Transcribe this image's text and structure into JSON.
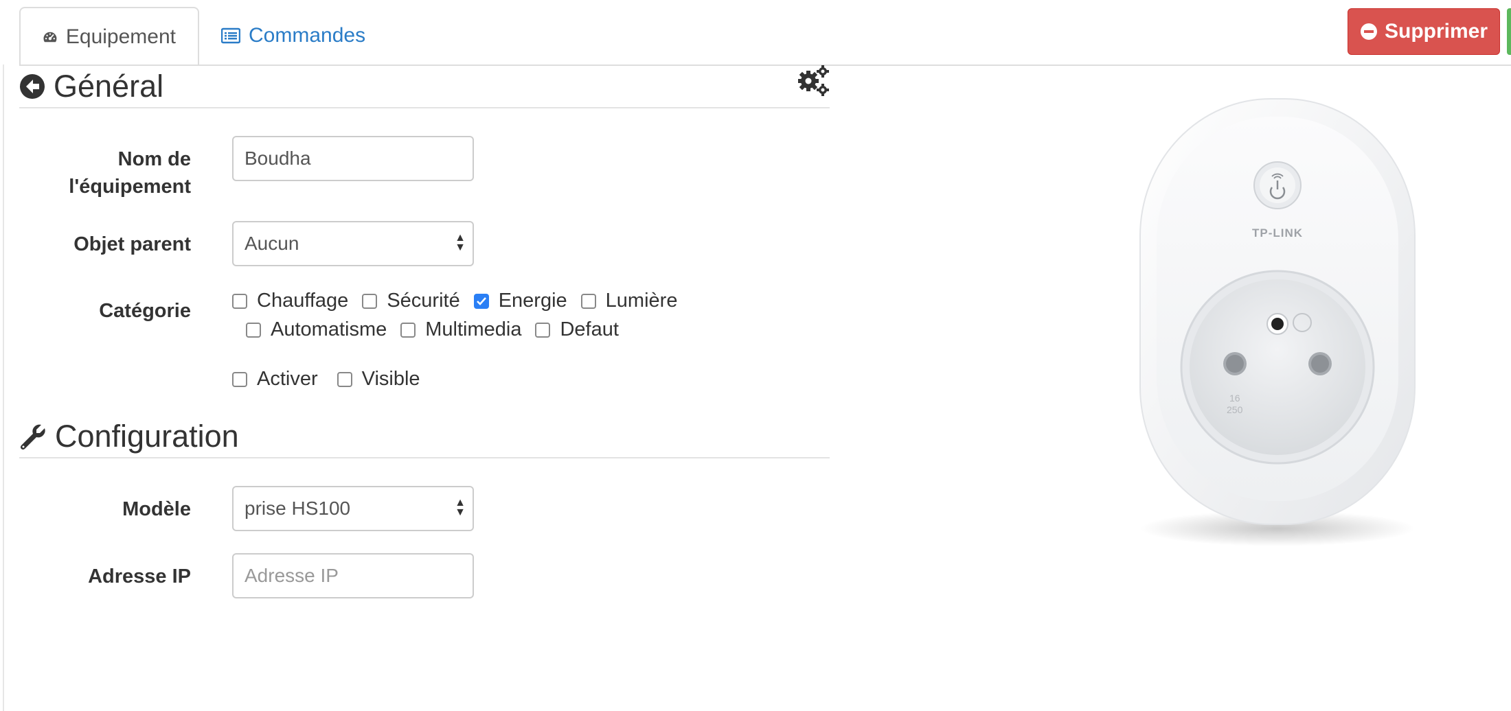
{
  "tabs": [
    {
      "label": "Equipement",
      "icon": "tachometer-icon",
      "active": true
    },
    {
      "label": "Commandes",
      "icon": "list-icon",
      "active": false
    }
  ],
  "actions": {
    "delete_label": "Supprimer",
    "delete_color": "#d9534f"
  },
  "sections": {
    "general_title": "Général",
    "config_title": "Configuration"
  },
  "form": {
    "name": {
      "label": "Nom de l'équipement",
      "value": "Boudha"
    },
    "parent": {
      "label": "Objet parent",
      "value": "Aucun"
    },
    "category": {
      "label": "Catégorie",
      "options": [
        {
          "label": "Chauffage",
          "checked": false
        },
        {
          "label": "Sécurité",
          "checked": false
        },
        {
          "label": "Energie",
          "checked": true
        },
        {
          "label": "Lumière",
          "checked": false
        },
        {
          "label": "Automatisme",
          "checked": false
        },
        {
          "label": "Multimedia",
          "checked": false
        },
        {
          "label": "Defaut",
          "checked": false
        }
      ]
    },
    "flags": [
      {
        "label": "Activer",
        "checked": false
      },
      {
        "label": "Visible",
        "checked": false
      }
    ],
    "model": {
      "label": "Modèle",
      "value": "prise HS100"
    },
    "ip": {
      "label": "Adresse IP",
      "placeholder": "Adresse IP",
      "value": ""
    }
  },
  "device_image": {
    "brand": "TP-LINK",
    "rating_top": "16",
    "rating_bottom": "250"
  },
  "colors": {
    "link": "#2a7cc7",
    "checkbox_checked": "#2a7ff5"
  }
}
